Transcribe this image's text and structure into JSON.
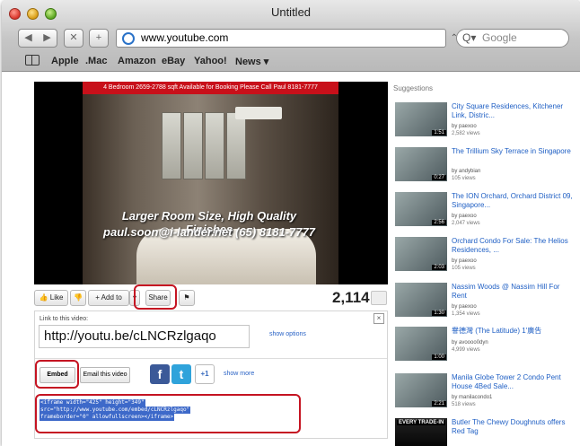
{
  "window": {
    "title": "Untitled"
  },
  "toolbar": {
    "back": "◀",
    "forward": "▶",
    "reload": "✕",
    "add_bookmark": "+",
    "url": "www.youtube.com",
    "rss": "⌃",
    "search_placeholder": "Google",
    "search_icon": "Q▾"
  },
  "bookmarks": {
    "items": [
      "Apple",
      ".Mac",
      "Amazon",
      "eBay",
      "Yahoo!",
      "News ▾"
    ]
  },
  "video": {
    "banner": "4 Bedroom 2659-2788 sqft Available for Booking Please Call Paul 8181-7777",
    "overlay_line1": "Larger Room Size, High Quality Finishes",
    "overlay_line2": "paul.soon@i-lander.net (65) 8181-7777"
  },
  "actions": {
    "like": "Like",
    "add_to": "Add to",
    "share": "Share",
    "views": "2,114"
  },
  "share_panel": {
    "link_label": "Link to this video:",
    "link_value": "http://youtu.be/cLNCRzlgaqo",
    "show_options": "show options",
    "embed": "Embed",
    "email": "Email this video",
    "show_more": "show more",
    "facebook_glyph": "f",
    "twitter_glyph": "t",
    "plusone_glyph": "+1",
    "close_glyph": "×",
    "embed_code": [
      "<iframe width=\"425\" height=\"349\"",
      "src=\"http://www.youtube.com/embed/cLNCRzlgaqo\"",
      "frameborder=\"0\" allowfullscreen></iframe>"
    ]
  },
  "suggestions": {
    "title": "Suggestions",
    "items": [
      {
        "title": "City Square Residences, Kitchener Link, Distric...",
        "by": "by paexoo",
        "views": "2,582 views",
        "duration": "1:51"
      },
      {
        "title": "The Trillium Sky Terrace in Singapore",
        "by": "by andybian",
        "views": "105 views",
        "duration": "0:27"
      },
      {
        "title": "The ION Orchard, Orchard District 09, Singapore...",
        "by": "by paexoo",
        "views": "2,047 views",
        "duration": "2:56"
      },
      {
        "title": "Orchard Condo For Sale: The Helios Residences, ...",
        "by": "by paexoo",
        "views": "105 views",
        "duration": "2:03"
      },
      {
        "title": "Nassim Woods @ Nassim Hill For Rent",
        "by": "by paexoo",
        "views": "1,354 views",
        "duration": "1:30"
      },
      {
        "title": "譽德灣 (The Latitude) 1'廣告",
        "by": "by avoooo0dyn",
        "views": "4,999 views",
        "duration": "1:00"
      },
      {
        "title": "Manila Globe Tower 2 Condo Pent House 4Bed Sale...",
        "by": "by manilacondo1",
        "views": "518 views",
        "duration": "2:21"
      },
      {
        "title": "Butler The Chewy Doughnuts offers Red Tag",
        "by": "",
        "views": "",
        "duration": "EVERY TRADE-IN"
      }
    ]
  }
}
